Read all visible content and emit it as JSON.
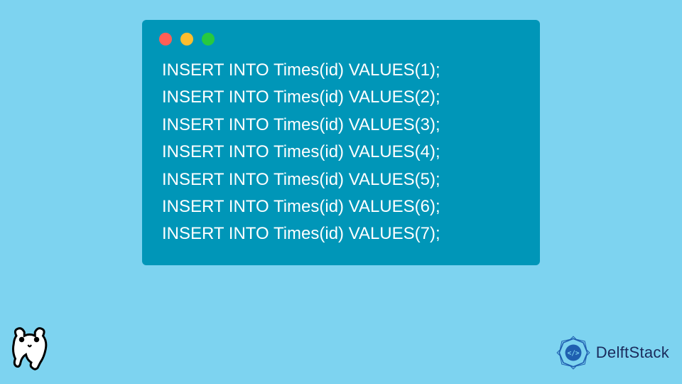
{
  "code": {
    "lines": [
      "INSERT INTO Times(id) VALUES(1);",
      "INSERT INTO Times(id) VALUES(2);",
      "INSERT INTO Times(id) VALUES(3);",
      "INSERT INTO Times(id) VALUES(4);",
      "INSERT INTO Times(id) VALUES(5);",
      "INSERT INTO Times(id) VALUES(6);",
      "INSERT INTO Times(id) VALUES(7);"
    ]
  },
  "brand": {
    "name": "DelftStack"
  },
  "colors": {
    "background": "#7dd3f0",
    "window": "#0096b8",
    "code_text": "#ffffff",
    "brand_text": "#1a2b5c"
  }
}
